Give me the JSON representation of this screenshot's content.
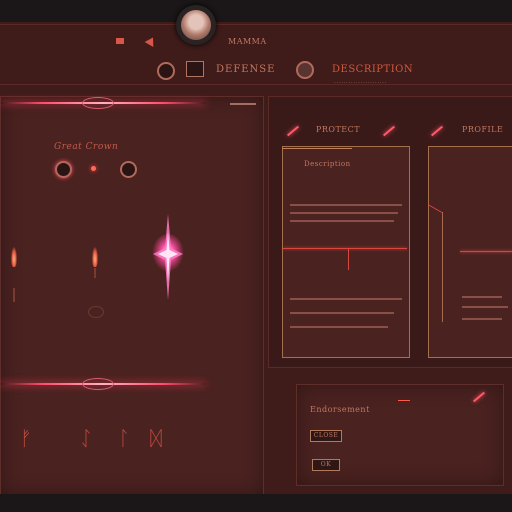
{
  "header": {
    "top_label": "MAMMA",
    "row_label_1": "DEFENSE",
    "row_label_2": "DESCRIPTION",
    "subline": "······················"
  },
  "left_panel": {
    "caption": "Great Crown",
    "runes": [
      "ᚠ",
      "ᛇ",
      "ᛚ",
      "ᛞ"
    ]
  },
  "right_top": {
    "tab_1": "PROTECT",
    "tab_2": "PROFILE",
    "card_1_title": "Description"
  },
  "right_bottom": {
    "label": "Endorsement",
    "button_1": "CLOSE",
    "button_2": "OK"
  },
  "colors": {
    "accent": "#ff4a6a",
    "panel": "#4a2220",
    "background": "#3f1c1a"
  }
}
